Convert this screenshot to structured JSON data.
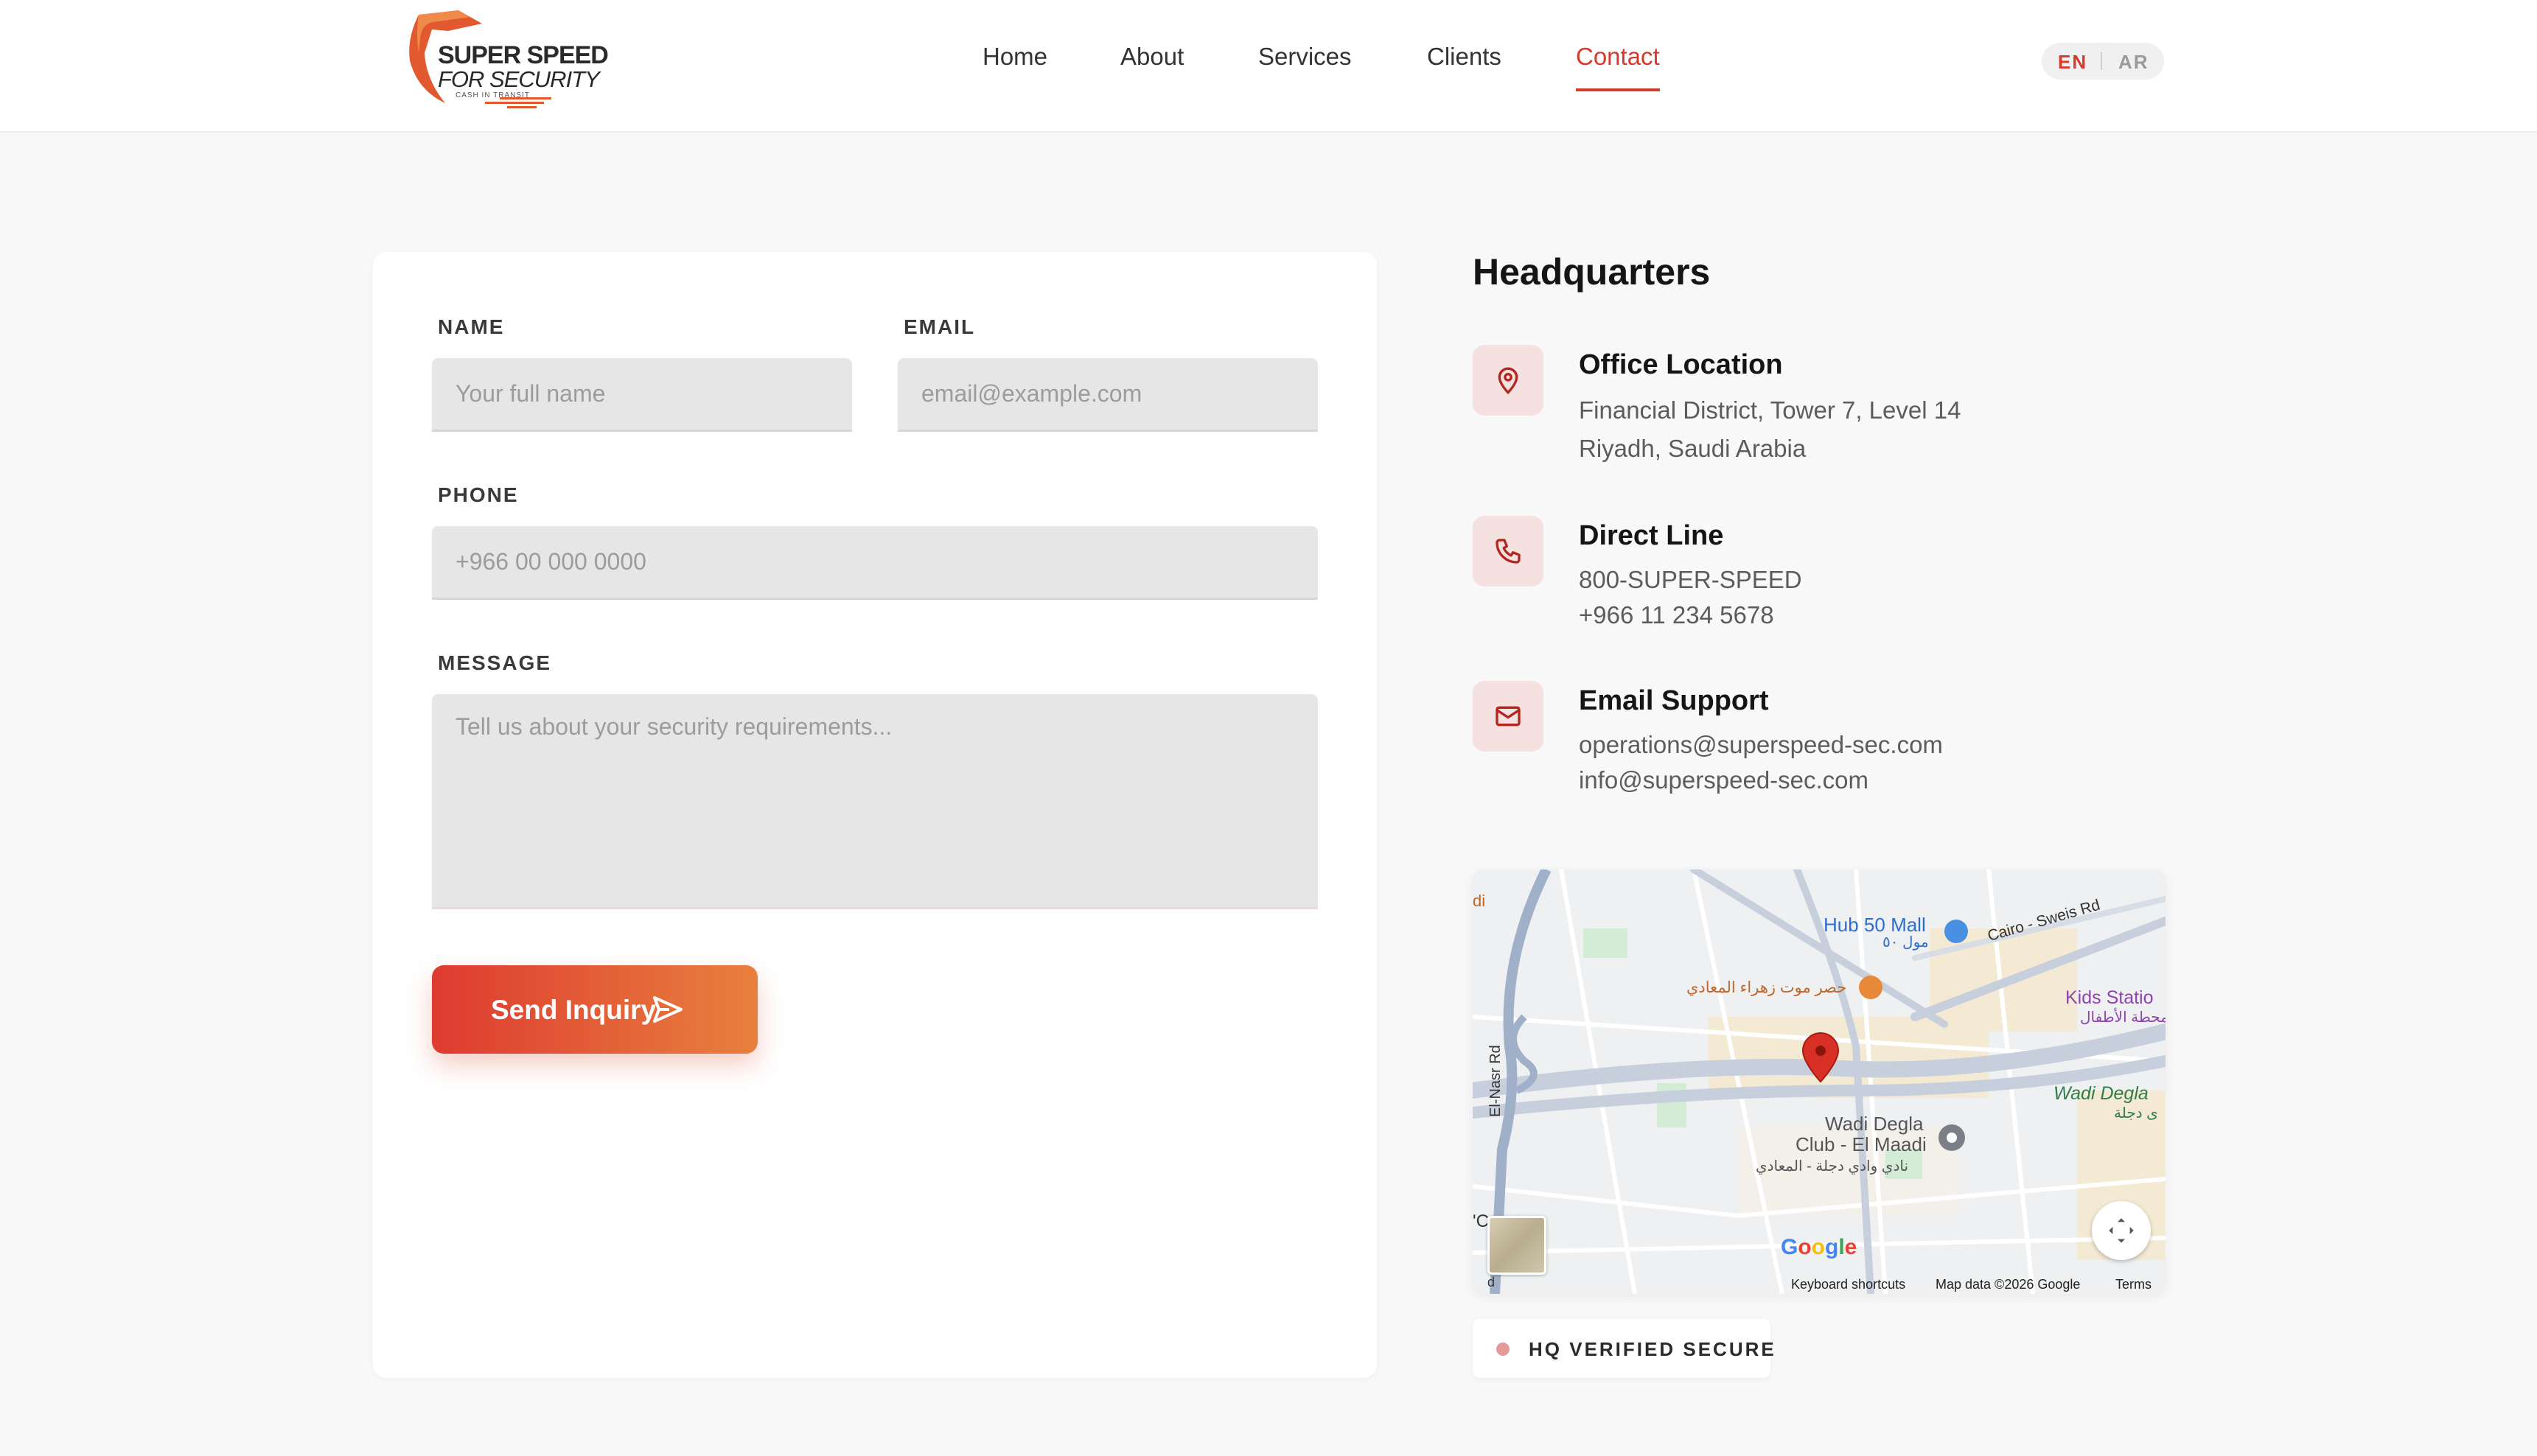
{
  "brand": {
    "line1": "SUPER SPEED",
    "line2": "FOR SECURITY",
    "tagline": "CASH IN TRANSIT",
    "accent_color": "#d63a2c",
    "logo_icon": "shield-logo-icon"
  },
  "nav": {
    "items": [
      {
        "label": "Home"
      },
      {
        "label": "About"
      },
      {
        "label": "Services"
      },
      {
        "label": "Clients"
      },
      {
        "label": "Contact",
        "active": true
      }
    ],
    "lang": {
      "en": "EN",
      "ar": "AR",
      "selected": "EN"
    }
  },
  "form": {
    "name_label": "NAME",
    "name_placeholder": "Your full name",
    "email_label": "EMAIL",
    "email_placeholder": "email@example.com",
    "phone_label": "PHONE",
    "phone_placeholder": "+966 00 000 0000",
    "message_label": "MESSAGE",
    "message_placeholder": "Tell us about your security requirements...",
    "submit_label": "Send Inquiry",
    "submit_icon": "send-icon"
  },
  "hq": {
    "title": "Headquarters",
    "office": {
      "icon": "map-pin-icon",
      "title": "Office Location",
      "line1": "Financial District, Tower 7, Level 14",
      "line2": "Riyadh, Saudi Arabia"
    },
    "phone": {
      "icon": "phone-icon",
      "title": "Direct Line",
      "line1": "800-SUPER-SPEED",
      "line2": "+966 11 234 5678"
    },
    "email": {
      "icon": "mail-icon",
      "title": "Email Support",
      "line1": "operations@superspeed-sec.com",
      "line2": "info@superspeed-sec.com"
    }
  },
  "map": {
    "labels": {
      "hub_mall": "Hub 50 Mall",
      "hub_mall_ar": "مول ٥٠",
      "road_cairo": "Cairo - Sweis Rd",
      "kids_station": "Kids Statio",
      "kids_station_ar": "محطة الأطفال",
      "restaurant_ar": "حصر موت زهراء المعادي",
      "wadi_degla_club": "Wadi Degla",
      "wadi_degla_club2": "Club - El Maadi",
      "wadi_degla_club_ar": "نادي وادي دجلة - المعادي",
      "wadi_degla_right": "Wadi Degla",
      "wadi_degla_right_ar": "ى دجلة",
      "el_nasr_rd": "El-Nasr Rd",
      "edge_left": "di",
      "edge_left2": "'C",
      "edge_left3": "d"
    },
    "google": "Google",
    "footer": {
      "shortcuts": "Keyboard shortcuts",
      "data": "Map data ©2026 Google",
      "terms": "Terms"
    },
    "pin_color": "#d93025",
    "fullscreen_icon": "fullscreen-icon"
  },
  "badge": {
    "label": "HQ VERIFIED SECURE",
    "dot_color": "#e59a9a"
  }
}
